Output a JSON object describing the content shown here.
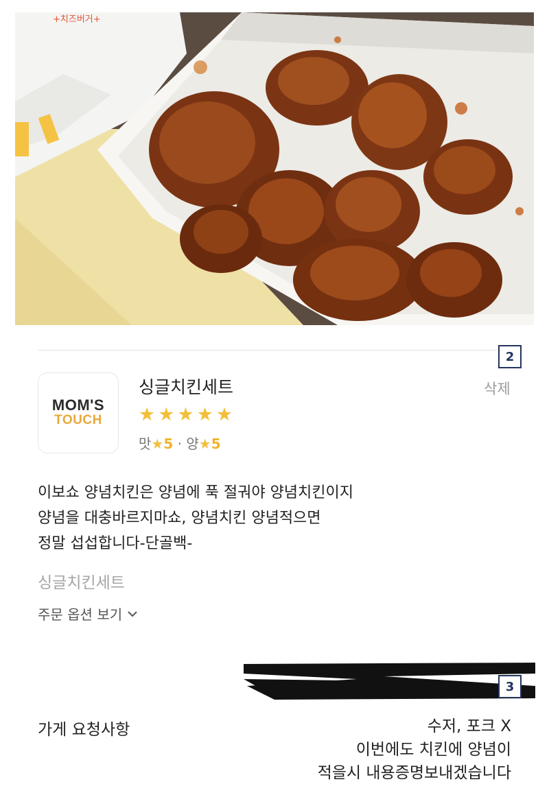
{
  "page_badges": {
    "first": "2",
    "second": "3"
  },
  "photo": {
    "package_text": "+치즈버거+",
    "icon": "fried-chicken-photo"
  },
  "store": {
    "logo_line1": "MOM'S",
    "logo_line2": "TOUCH",
    "brand_color": "#e9a83b"
  },
  "review": {
    "menu_name": "싱글치킨세트",
    "delete_label": "삭제",
    "rating_stars": 5,
    "star_glyphs": "★★★★★",
    "sub_ratings": {
      "taste_label": "맛",
      "taste_score": "5",
      "separator": "·",
      "amount_label": "양",
      "amount_score": "5"
    },
    "body_lines": [
      "이보쇼 양념치킨은 양념에 푹 절궈야 양념치킨이지",
      "양념을 대충바르지마쇼, 양념치킨 양념적으면",
      "정말 섭섭합니다-단골백-"
    ],
    "menu_tag": "싱글치킨세트",
    "option_toggle": "주문 옵션 보기"
  },
  "request": {
    "label": "가게 요청사항",
    "lines": [
      "수저, 포크 X",
      "이번에도 치킨에 양념이",
      "적을시 내용증명보내겠습니다"
    ]
  },
  "colors": {
    "star": "#f3bf3a",
    "badge_border": "#23355f",
    "muted": "#9a9a9a"
  }
}
